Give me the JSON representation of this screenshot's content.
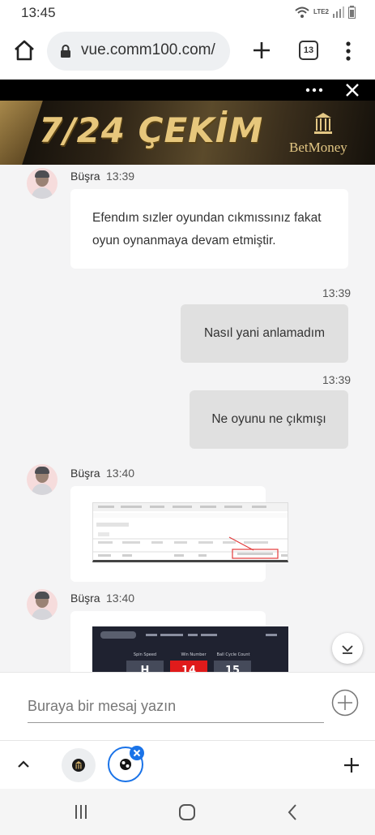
{
  "status_bar": {
    "time": "13:45",
    "network_label": "LTE2"
  },
  "browser": {
    "url": "vue.comm100.com/",
    "tab_count": "13"
  },
  "banner": {
    "headline": "7/24 ÇEKİM",
    "brand": "BetMoney"
  },
  "messages": [
    {
      "sender": "Büşra",
      "time": "13:39",
      "text": "Efendım sızler oyundan cıkmıssınız fakat oyun oynanmaya devam etmiştir."
    },
    {
      "time": "13:39",
      "text": "Nasıl yani anlamadım"
    },
    {
      "time": "13:39",
      "text": "Ne oyunu ne çıkmışı"
    },
    {
      "sender": "Büşra",
      "time": "13:40"
    },
    {
      "sender": "Büşra",
      "time": "13:40",
      "shot_labels": [
        "Spin Speed",
        "Win Number",
        "Ball Cycle Count"
      ],
      "shot_values": [
        "H",
        "14",
        "15"
      ]
    }
  ],
  "composer": {
    "placeholder": "Buraya bir mesaj yazın"
  },
  "colors": {
    "accent_blue": "#1a73e8",
    "banner_gold": "#e7c77c",
    "visitor_bubble": "#e0e0e0",
    "chat_background": "#f4f4f5"
  }
}
